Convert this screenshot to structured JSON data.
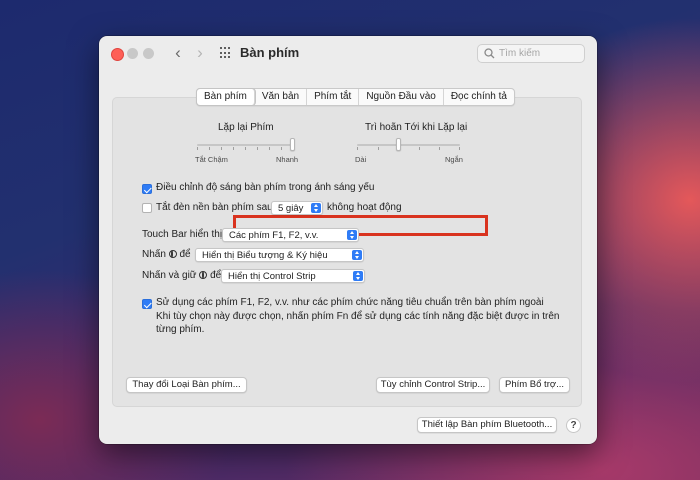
{
  "window": {
    "title": "Bàn phím",
    "search_placeholder": "Tìm kiếm",
    "back_glyph": "‹",
    "forward_glyph": "›"
  },
  "tabs": [
    {
      "label": "Bàn phím",
      "active": true
    },
    {
      "label": "Văn bản",
      "active": false
    },
    {
      "label": "Phím tắt",
      "active": false
    },
    {
      "label": "Nguồn Đầu vào",
      "active": false
    },
    {
      "label": "Đọc chính tả",
      "active": false
    }
  ],
  "key_repeat": {
    "label": "Lặp lại Phím",
    "min_labels": "Tắt  Chậm",
    "max_label": "Nhanh",
    "value_fraction": 1.0
  },
  "repeat_delay": {
    "label": "Trì hoãn Tới khi Lặp lại",
    "min_label": "Dài",
    "max_label": "Ngắn",
    "value_fraction": 0.4
  },
  "options": {
    "adjust_brightness": {
      "label": "Điều chỉnh độ sáng bàn phím trong ánh sáng yếu",
      "checked": true
    },
    "backlight_off": {
      "label_before": "Tắt đèn nền bàn phím sau",
      "value": "5 giây",
      "label_after": "không hoạt động",
      "checked": false
    }
  },
  "touch_bar": {
    "label": "Touch Bar hiển thị",
    "value": "Các phím F1, F2, v.v."
  },
  "press_globe": {
    "label_before": "Nhấn",
    "label_after": "để",
    "value": "Hiển thị Biểu tượng & Ký hiệu"
  },
  "hold_globe": {
    "label_before": "Nhấn và giữ",
    "label_after": "để",
    "value": "Hiển thị Control Strip"
  },
  "function_keys": {
    "checked": true,
    "label": "Sử dụng các phím F1, F2, v.v. như các phím chức năng tiêu chuẩn trên bàn phím ngoài",
    "description_line1": "Khi tùy chọn này được chọn, nhấn phím Fn để sử dụng các tính năng đặc biệt được in trên",
    "description_line2": "từng phím."
  },
  "buttons": {
    "change_type": "Thay đổi Loại Bàn phím...",
    "customize_strip": "Tùy chỉnh Control Strip...",
    "modifier_keys": "Phím Bổ trợ...",
    "bluetooth_setup": "Thiết lập Bàn phím Bluetooth...",
    "help": "?"
  },
  "colors": {
    "accent": "#2f7cf6",
    "highlight_box": "#d9331f",
    "close_button": "#fe5f57"
  }
}
